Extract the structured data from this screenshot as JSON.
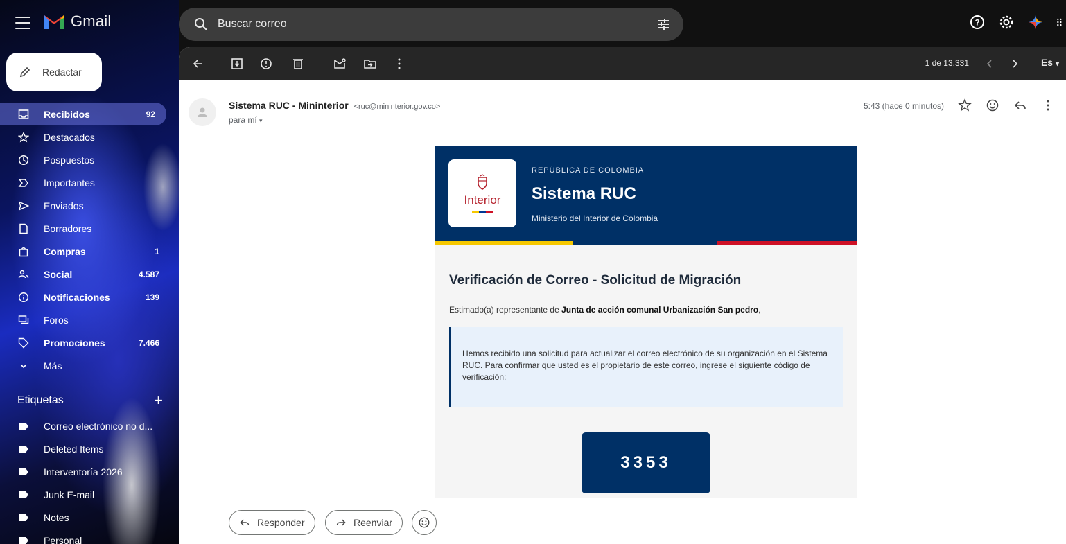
{
  "app": {
    "logo_text": "Gmail"
  },
  "search": {
    "placeholder": "Buscar correo"
  },
  "compose": {
    "label": "Redactar"
  },
  "nav": {
    "items": [
      {
        "label": "Recibidos",
        "count": "92",
        "bold": true,
        "icon": "inbox-icon"
      },
      {
        "label": "Destacados",
        "count": "",
        "bold": false,
        "icon": "star-icon"
      },
      {
        "label": "Pospuestos",
        "count": "",
        "bold": false,
        "icon": "clock-icon"
      },
      {
        "label": "Importantes",
        "count": "",
        "bold": false,
        "icon": "important-icon"
      },
      {
        "label": "Enviados",
        "count": "",
        "bold": false,
        "icon": "send-icon"
      },
      {
        "label": "Borradores",
        "count": "",
        "bold": false,
        "icon": "draft-icon"
      },
      {
        "label": "Compras",
        "count": "1",
        "bold": true,
        "icon": "shopping-icon"
      },
      {
        "label": "Social",
        "count": "4.587",
        "bold": true,
        "icon": "social-icon"
      },
      {
        "label": "Notificaciones",
        "count": "139",
        "bold": true,
        "icon": "info-icon"
      },
      {
        "label": "Foros",
        "count": "",
        "bold": false,
        "icon": "forum-icon"
      },
      {
        "label": "Promociones",
        "count": "7.466",
        "bold": true,
        "icon": "tag-icon"
      },
      {
        "label": "Más",
        "count": "",
        "bold": false,
        "icon": "chevron-down-icon"
      }
    ]
  },
  "labels": {
    "header": "Etiquetas",
    "add": "+",
    "items": [
      "Correo electrónico no d...",
      "Deleted Items",
      "Interventoría 2026",
      "Junk E-mail",
      "Notes",
      "Personal"
    ]
  },
  "toolbar": {
    "pager": "1 de 13.331",
    "language": "Es"
  },
  "message": {
    "sender_name": "Sistema RUC - Mininterior",
    "sender_email": "<ruc@mininterior.gov.co>",
    "to": "para mí",
    "time": "5:43 (hace 0 minutos)"
  },
  "email": {
    "logo_word": "Interior",
    "country": "REPÚBLICA DE COLOMBIA",
    "title": "Sistema RUC",
    "subtitle": "Ministerio del Interior de Colombia",
    "heading": "Verificación de Correo - Solicitud de Migración",
    "greeting_prefix": "Estimado(a) representante de ",
    "greeting_org": "Junta de acción comunal Urbanización San pedro",
    "greeting_suffix": ",",
    "info": "Hemos recibido una solicitud para actualizar el correo electrónico de su organización en el Sistema RUC. Para confirmar que usted es el propietario de este correo, ingrese el siguiente código de verificación:",
    "code": "3353"
  },
  "reply": {
    "reply_label": "Responder",
    "forward_label": "Reenviar"
  },
  "colors": {
    "accent_navy": "#003066",
    "flag_yellow": "#f6c800",
    "flag_red": "#ce1126"
  }
}
